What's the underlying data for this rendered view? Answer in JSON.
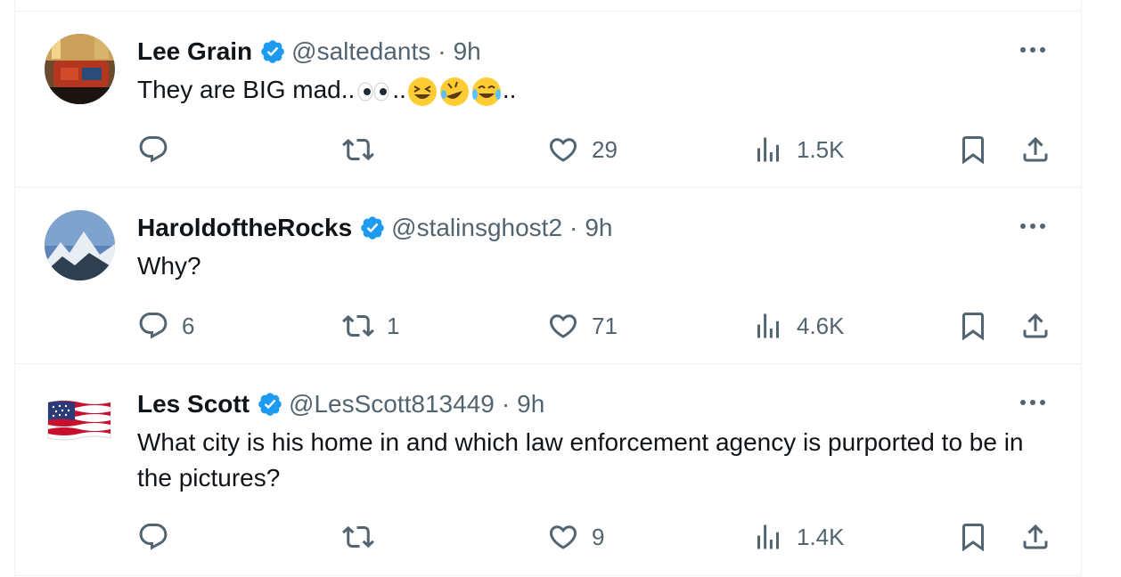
{
  "colors": {
    "text": "#0f1419",
    "secondary": "#536471",
    "verified": "#1d9bf0",
    "border": "#eff3f4"
  },
  "tweets": [
    {
      "name": "Lee Grain",
      "handle": "@saltedants",
      "dot": "·",
      "time": "9h",
      "text_before": "They are BIG mad..",
      "text_mid": "..",
      "text_after": "..",
      "emojis": [
        "eyes-emoji",
        "grinning-squinting-emoji",
        "rolling-laughing-emoji",
        "tears-of-joy-emoji"
      ],
      "counts": {
        "replies": "",
        "reposts": "",
        "likes": "29",
        "views": "1.5K"
      }
    },
    {
      "name": "HaroldoftheRocks",
      "handle": "@stalinsghost2",
      "dot": "·",
      "time": "9h",
      "text": "Why?",
      "counts": {
        "replies": "6",
        "reposts": "1",
        "likes": "71",
        "views": "4.6K"
      }
    },
    {
      "name": "Les Scott",
      "handle": "@LesScott813449",
      "dot": "·",
      "time": "9h",
      "text": "What city is his home in and which law enforcement agency is purported to be in the pictures?",
      "counts": {
        "replies": "",
        "reposts": "",
        "likes": "9",
        "views": "1.4K"
      }
    }
  ]
}
